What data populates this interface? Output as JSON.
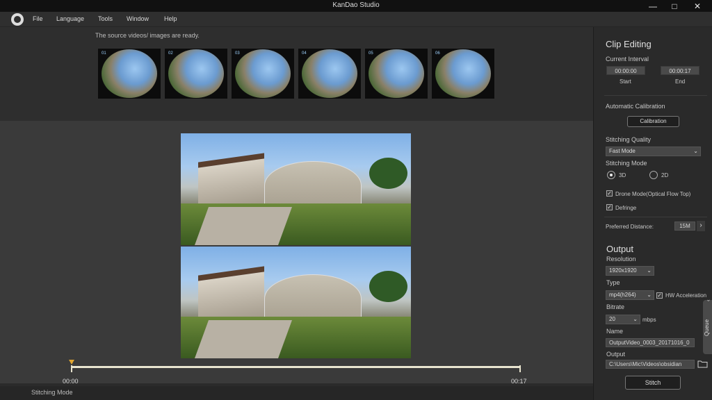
{
  "window": {
    "title": "KanDao Studio",
    "minimize_icon": "minimize-icon",
    "maximize_icon": "maximize-icon",
    "close_icon": "close-icon"
  },
  "menu": [
    "File",
    "Language",
    "Tools",
    "Window",
    "Help"
  ],
  "source": {
    "message": "The source videos/ images are ready.",
    "thumbnails": [
      "01",
      "02",
      "03",
      "04",
      "05",
      "06"
    ]
  },
  "timeline": {
    "start": "00:00",
    "end": "00:17",
    "progress": 0.0
  },
  "status": {
    "text": "Stitching Mode"
  },
  "clip_editing": {
    "title": "Clip Editing",
    "interval_label": "Current Interval",
    "start_value": "00:00:00",
    "end_value": "00:00:17",
    "start_label": "Start",
    "end_label": "End",
    "auto_calibration_label": "Automatic Calibration",
    "calibration_button": "Calibration",
    "quality_label": "Stitching Quality",
    "quality_value": "Fast Mode",
    "mode_label": "Stitching Mode",
    "mode_3d": "3D",
    "mode_2d": "2D",
    "selected_mode": "3D",
    "drone_mode": "Drone Mode(Optical Flow Top)",
    "drone_checked": true,
    "defringe": "Defringe",
    "defringe_checked": true,
    "distance_label": "Preferred Distance:",
    "distance_value": "15M"
  },
  "output": {
    "title": "Output",
    "resolution_label": "Resolution",
    "resolution_value": "1920x1920",
    "type_label": "Type",
    "type_value": "mp4(h264)",
    "hw_label": "HW Acceleration",
    "hw_checked": true,
    "bitrate_label": "Bitrate",
    "bitrate_value": "20",
    "bitrate_unit": "mbps",
    "name_label": "Name",
    "name_value": "OutputVideo_0003_20171016_0",
    "output_label": "Output",
    "output_value": "C:\\Users\\Mic\\Videos\\obsidian",
    "folder_icon": "folder-icon",
    "stitch_button": "Stitch"
  },
  "queue": {
    "label": "Queue"
  }
}
